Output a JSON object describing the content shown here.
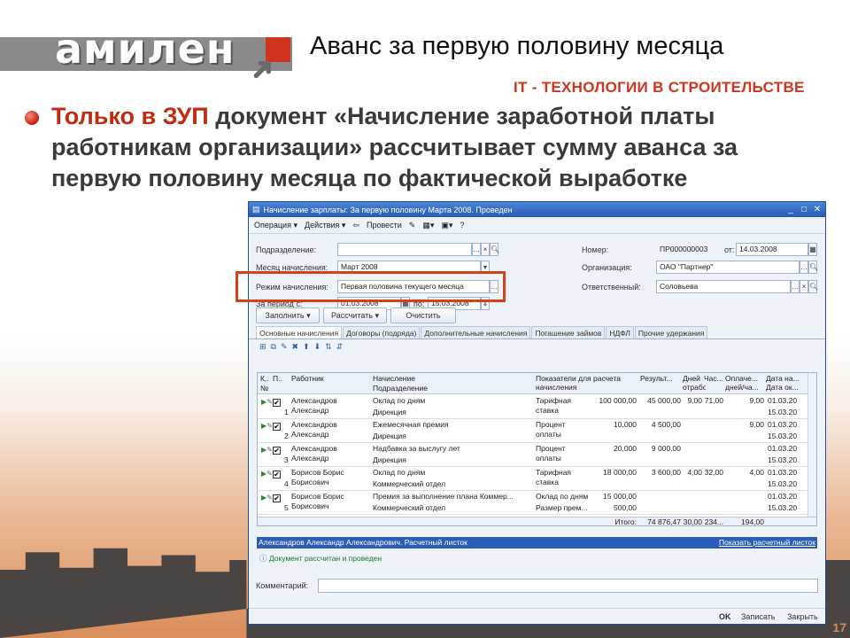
{
  "slide": {
    "logo": "амилен",
    "title": "Аванс за первую половину месяца",
    "tagline": "IT - ТЕХНОЛОГИИ В СТРОИТЕЛЬСТВЕ",
    "text_highlight": "Только в ЗУП",
    "text_rest": " документ «Начисление заработной платы работникам организации» рассчитывает сумму аванса за первую половину месяца по фактической выработке",
    "page": "17",
    "colors": {
      "accent": "#d0341e",
      "window_title": "#2659b4"
    }
  },
  "window": {
    "title": "Начисление зарплаты: За первую половину Марта 2008. Проведен",
    "toolbar": {
      "operation": "Операция ▾",
      "actions": "Действия ▾",
      "post": "Провести"
    },
    "form": {
      "dept_label": "Подразделение:",
      "month_label": "Месяц начисления:",
      "month_value": "Март 2008",
      "mode_label": "Режим начисления:",
      "mode_value": "Первая половина текущего месяца",
      "period_label": "За период с:",
      "period_from": "01.03.2008",
      "period_to_label": "по:",
      "period_to": "15.03.2008",
      "number_label": "Номер:",
      "number_value": "ПР000000003",
      "date_label": "от:",
      "date_value": "14.03.2008",
      "org_label": "Организация:",
      "org_value": "ОАО \"Партнер\"",
      "resp_label": "Ответственный:",
      "resp_value": "Соловьева"
    },
    "buttons": {
      "fill": "Заполнить",
      "calc": "Рассчитать",
      "clear": "Очистить"
    },
    "tabs": [
      "Основные начисления",
      "Договоры (подряда)",
      "Дополнительные начисления",
      "Погашение займов",
      "НДФЛ",
      "Прочие удержания"
    ],
    "grid": {
      "headers": {
        "k": "К..",
        "p": "П..",
        "no": "№",
        "worker": "Работник",
        "accrual": "Начисление",
        "dept": "Подразделение",
        "indicators": "Показатели для расчета начисления",
        "result": "Результ...",
        "days": "Дней отработ...",
        "hours": "Час...",
        "paid": "Оплаче... дней/ча...",
        "date": "Дата на... Дата ок..."
      },
      "rows": [
        {
          "n": "1",
          "worker": "Александров Александр",
          "accrual": "Оклад по дням",
          "dept": "Дирекция",
          "ind": "Тарифная ставка",
          "ind_val": "100 000,00",
          "ind_val2": "",
          "result": "45 000,00",
          "days": "9,00",
          "hours": "71,00",
          "paid": "9,00",
          "d1": "01.03.20",
          "d2": "15.03.20"
        },
        {
          "n": "2",
          "worker": "Александров Александр",
          "accrual": "Ежемесячная премия",
          "dept": "Дирекция",
          "ind": "Процент оплаты",
          "ind_val": "10,000",
          "ind_val2": "",
          "result": "4 500,00",
          "days": "",
          "hours": "",
          "paid": "9,00",
          "d1": "01.03.20",
          "d2": "15.03.20"
        },
        {
          "n": "3",
          "worker": "Александров Александр",
          "accrual": "Надбавка за выслугу лет",
          "dept": "Дирекция",
          "ind": "Процент оплаты",
          "ind_val": "20,000",
          "ind_val2": "",
          "result": "9 000,00",
          "days": "",
          "hours": "",
          "paid": "",
          "d1": "01.03.20",
          "d2": "15.03.20"
        },
        {
          "n": "4",
          "worker": "Борисов Борис Борисович",
          "accrual": "Оклад по дням",
          "dept": "Коммерческий отдел",
          "ind": "Тарифная ставка",
          "ind_val": "18 000,00",
          "ind_val2": "",
          "result": "3 600,00",
          "days": "4,00",
          "hours": "32,00",
          "paid": "4,00",
          "d1": "01.03.20",
          "d2": "15.03.20"
        },
        {
          "n": "5",
          "worker": "Борисов Борис Борисович",
          "accrual": "Премия за выполнение плана Коммер...",
          "dept": "Коммерческий отдел",
          "ind": "Оклад по дням",
          "ind_val": "15 000,00",
          "ind_val2": "500,00",
          "ind2": "Размер прем...",
          "result": "",
          "days": "",
          "hours": "",
          "paid": "",
          "d1": "01.03.20",
          "d2": "15.03.20"
        }
      ],
      "total_label": "Итого:",
      "total_result": "74 876,47",
      "total_days": "30,00",
      "total_hours": "234...",
      "total_paid": "194,00"
    },
    "selected": "Александров Александр Александрович. Расчетный листок",
    "show_sheet": "Показать расчетный листок",
    "status": "Документ рассчитан и проведен",
    "comment_label": "Комментарий:",
    "footer": {
      "ok": "OK",
      "save": "Записать",
      "close": "Закрыть"
    }
  }
}
